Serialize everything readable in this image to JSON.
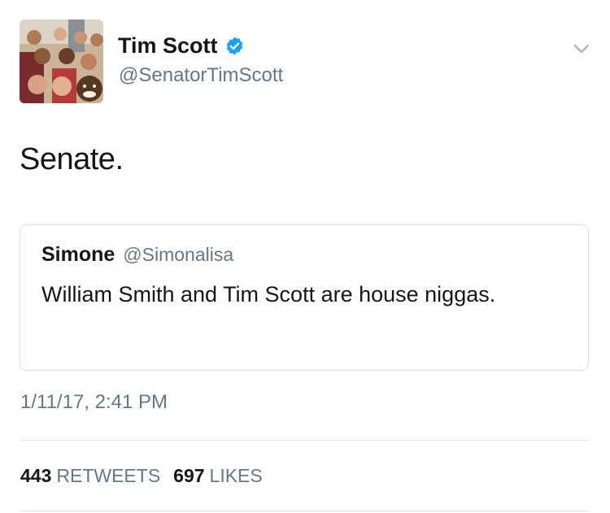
{
  "tweet": {
    "author": {
      "name": "Tim Scott",
      "handle": "@SenatorTimScott",
      "verified": true,
      "avatar_icon": "group-selfie-photo"
    },
    "text": "Senate.",
    "quoted": {
      "name": "Simone",
      "handle": "@Simonalisa",
      "text": "William Smith and Tim Scott are house niggas."
    },
    "timestamp": "1/11/17, 2:41 PM",
    "stats": {
      "retweets_count": "443",
      "retweets_label": "RETWEETS",
      "likes_count": "697",
      "likes_label": "LIKES"
    }
  },
  "colors": {
    "verified_blue": "#1da1f2",
    "secondary_text": "#657786",
    "primary_text": "#14171a",
    "border": "#d8dee2"
  }
}
